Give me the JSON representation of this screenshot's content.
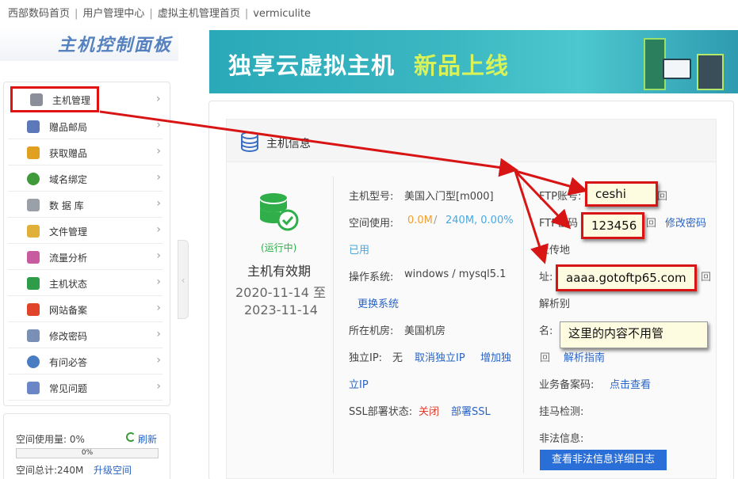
{
  "breadcrumb": [
    "西部数码首页",
    "用户管理中心",
    "虚拟主机管理首页",
    "vermiculite"
  ],
  "sidebar": {
    "logo_text": "主机控制面板",
    "items": [
      {
        "label": "主机管理",
        "icon": "server-icon",
        "color": "#8a8f99"
      },
      {
        "label": "赠品邮局",
        "icon": "mail-icon",
        "color": "#5b79b8"
      },
      {
        "label": "获取赠品",
        "icon": "gift-icon",
        "color": "#e0a020"
      },
      {
        "label": "域名绑定",
        "icon": "globe-icon",
        "color": "#3f9a3b"
      },
      {
        "label": "数 据 库",
        "icon": "database-icon",
        "color": "#9aa0a8"
      },
      {
        "label": "文件管理",
        "icon": "folder-user-icon",
        "color": "#e1b03a"
      },
      {
        "label": "流量分析",
        "icon": "chart-icon",
        "color": "#c85aa0"
      },
      {
        "label": "主机状态",
        "icon": "status-icon",
        "color": "#2d9d4a"
      },
      {
        "label": "网站备案",
        "icon": "record-icon",
        "color": "#e0442a"
      },
      {
        "label": "修改密码",
        "icon": "edit-password-icon",
        "color": "#7a8fb5"
      },
      {
        "label": "有问必答",
        "icon": "qa-user-icon",
        "color": "#4a7cc4"
      },
      {
        "label": "常见问题",
        "icon": "faq-icon",
        "color": "#6a86c7"
      }
    ],
    "usage": {
      "used_label": "空间使用量: 0%",
      "refresh": "刷新",
      "progress_label": "0%",
      "progress_value": 0,
      "total_label": "空间总计:240M",
      "upgrade": "升级空间"
    }
  },
  "banner": {
    "title_main": "独享云虚拟主机",
    "title_accent": "新品上线"
  },
  "host": {
    "section_title": "主机信息",
    "status": "(运行中)",
    "validity_label": "主机有效期",
    "date_from": "2020-11-14 至",
    "date_to": "2023-11-14",
    "model_label": "主机型号:",
    "model_value": "美国入门型[m000]",
    "space_label": "空间使用:",
    "space_used": "0.0M",
    "space_sep": " / ",
    "space_total": "240M",
    "space_pct": ",  0.00%",
    "space_used_text": "已用",
    "os_label": "操作系统:",
    "os_value": "windows / mysql5.1",
    "os_change": "更换系统",
    "room_label": "所在机房:",
    "room_value": "美国机房",
    "ip_label": "独立IP:",
    "ip_value": "无",
    "ip_cancel": "取消独立IP",
    "ip_add_1": "增加独",
    "ip_add_2": "立IP",
    "ssl_label": "SSL部署状态:",
    "ssl_value": "关闭",
    "ssl_deploy": "部署SSL",
    "ftp_user_label": "FTP账号:",
    "ftp_pwd_label": "FTP密码",
    "ftp_pwd_change": "修改密码",
    "upload_label": "上传地",
    "addr_label": "址:",
    "resolve_label": "解析别",
    "name_label": "名:",
    "resolve_guide": "解析指南",
    "icp_label": "业务备案码:",
    "icp_link": "点击查看",
    "trojan_label": "挂马检测:",
    "illegal_label": "非法信息:",
    "illegal_button": "查看非法信息详细日志",
    "copy_glyph": "回"
  },
  "annotations": {
    "ftp_user": "ceshi",
    "ftp_pwd": "123456",
    "upload_addr": "aaaa.gotoftp65.com",
    "ignore_note": "这里的内容不用管",
    "accent_color": "#d81515"
  }
}
